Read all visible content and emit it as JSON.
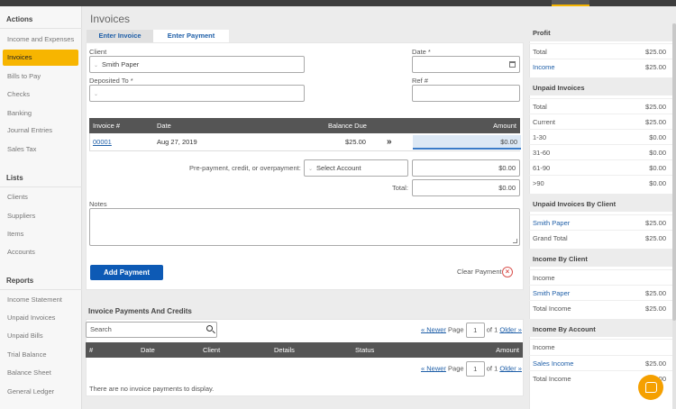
{
  "page": {
    "title": "Invoices"
  },
  "sidebar": {
    "sections": [
      {
        "heading": "Actions",
        "items": [
          {
            "label": "Income and Expenses"
          },
          {
            "label": "Invoices",
            "active": true
          },
          {
            "label": "Bills to Pay"
          },
          {
            "label": "Checks"
          },
          {
            "label": "Banking"
          },
          {
            "label": "Journal Entries"
          },
          {
            "label": "Sales Tax"
          }
        ]
      },
      {
        "heading": "Lists",
        "items": [
          {
            "label": "Clients"
          },
          {
            "label": "Suppliers"
          },
          {
            "label": "Items"
          },
          {
            "label": "Accounts"
          }
        ]
      },
      {
        "heading": "Reports",
        "items": [
          {
            "label": "Income Statement"
          },
          {
            "label": "Unpaid Invoices"
          },
          {
            "label": "Unpaid Bills"
          },
          {
            "label": "Trial Balance"
          },
          {
            "label": "Balance Sheet"
          },
          {
            "label": "General Ledger"
          }
        ]
      }
    ]
  },
  "tabs": [
    {
      "label": "Enter Invoice"
    },
    {
      "label": "Enter Payment",
      "active": true
    }
  ],
  "form": {
    "client_label": "Client",
    "client_value": "Smith Paper",
    "date_label": "Date *",
    "deposited_label": "Deposited To *",
    "ref_label": "Ref #",
    "table": {
      "headers": [
        "Invoice #",
        "Date",
        "Balance Due",
        "Amount"
      ],
      "rows": [
        {
          "invoice": "00001",
          "date": "Aug 27, 2019",
          "balance": "$25.00",
          "amount": "$0.00"
        }
      ]
    },
    "prepayment_label": "Pre-payment, credit, or overpayment:",
    "prepayment_account": "Select Account",
    "prepayment_amount": "$0.00",
    "total_label": "Total:",
    "total_amount": "$0.00",
    "notes_label": "Notes",
    "add_payment_label": "Add Payment",
    "clear_payment_label": "Clear Payment"
  },
  "payments": {
    "title": "Invoice Payments And Credits",
    "search_placeholder": "Search",
    "pager": {
      "newer": "« Newer",
      "page_label": "Page",
      "page": "1",
      "of_label": "of 1",
      "older": "Older »"
    },
    "headers": [
      "#",
      "Date",
      "Client",
      "Details",
      "Status",
      "Amount"
    ],
    "empty_text": "There are no invoice payments to display."
  },
  "right_panel": {
    "profit": {
      "title": "Profit",
      "rows": [
        {
          "label": "Total",
          "value": "$25.00"
        },
        {
          "label": "Income",
          "value": "$25.00",
          "link": true
        }
      ]
    },
    "unpaid": {
      "title": "Unpaid Invoices",
      "rows": [
        {
          "label": "Total",
          "value": "$25.00"
        },
        {
          "label": "Current",
          "value": "$25.00"
        },
        {
          "label": "1-30",
          "value": "$0.00"
        },
        {
          "label": "31-60",
          "value": "$0.00"
        },
        {
          "label": "61-90",
          "value": "$0.00"
        },
        {
          "label": ">90",
          "value": "$0.00"
        }
      ]
    },
    "unpaid_by_client": {
      "title": "Unpaid Invoices By Client",
      "rows": [
        {
          "label": "Smith Paper",
          "value": "$25.00",
          "link": true
        },
        {
          "label": "Grand Total",
          "value": "$25.00"
        }
      ]
    },
    "income_by_client": {
      "title": "Income By Client",
      "rows": [
        {
          "label": "Income",
          "value": ""
        },
        {
          "label": "Smith Paper",
          "value": "$25.00",
          "link": true
        },
        {
          "label": "Total Income",
          "value": "$25.00"
        }
      ]
    },
    "income_by_account": {
      "title": "Income By Account",
      "rows": [
        {
          "label": "Income",
          "value": ""
        },
        {
          "label": "Sales Income",
          "value": "$25.00",
          "link": true
        },
        {
          "label": "Total Income",
          "value": ".00"
        }
      ]
    }
  },
  "colors": {
    "accent": "#f7b500",
    "primary": "#0d5ab5",
    "link": "#1f5fa8",
    "header": "#555555"
  }
}
